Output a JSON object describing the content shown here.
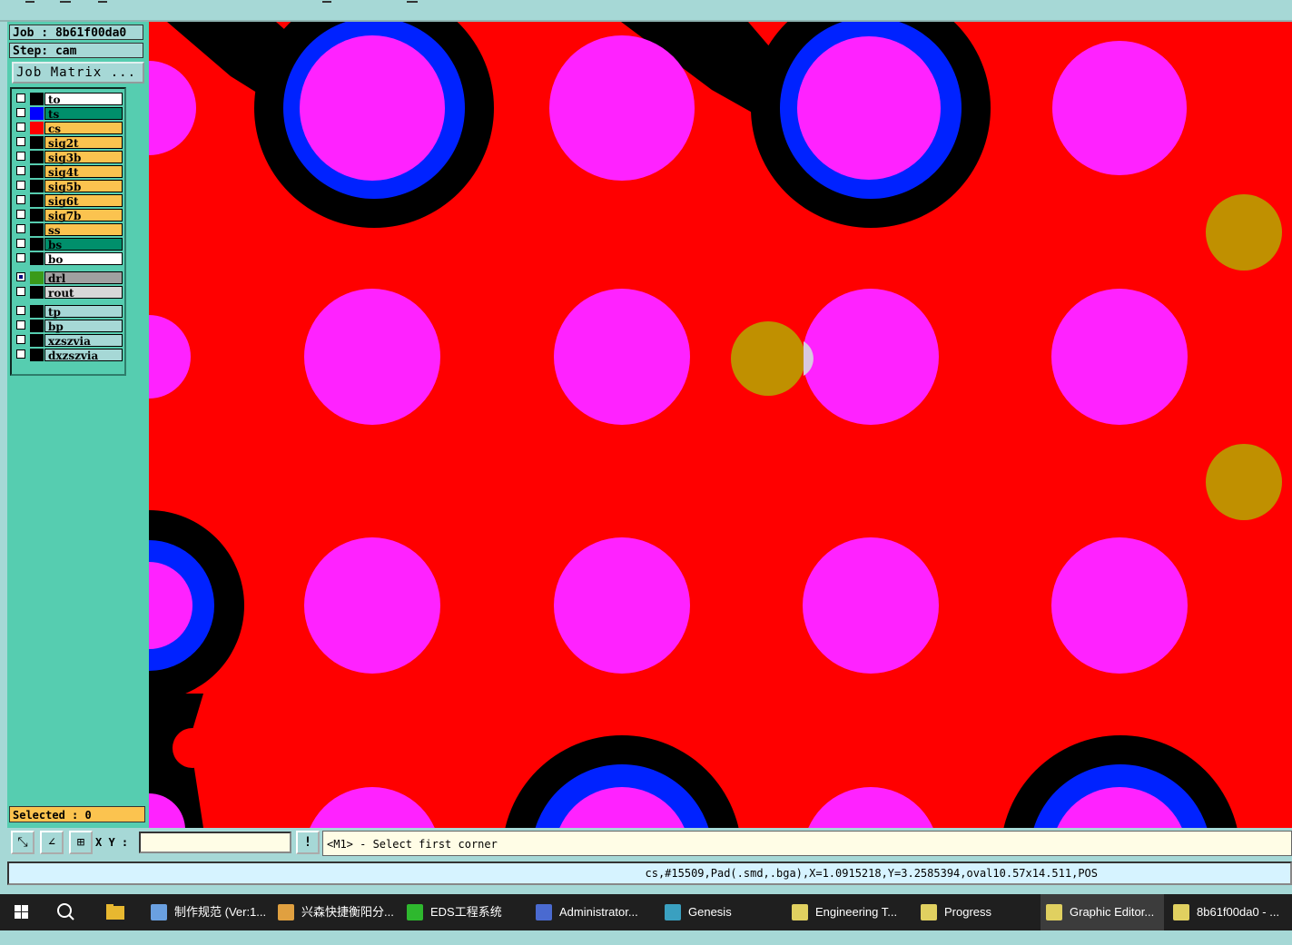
{
  "panel": {
    "job": "Job : 8b61f00da0",
    "step": "Step: cam",
    "matrix_button": "Job Matrix ...",
    "selected": "Selected : 0"
  },
  "layers": [
    {
      "name": "to",
      "swatch": "#000000",
      "bg": "#ffffff",
      "checked": false
    },
    {
      "name": "ts",
      "swatch": "#0000ff",
      "bg": "#008f6b",
      "checked": false
    },
    {
      "name": "cs",
      "swatch": "#ff0000",
      "bg": "#fbc34f",
      "checked": false
    },
    {
      "name": "sig2t",
      "swatch": "#000000",
      "bg": "#fbc34f",
      "checked": false
    },
    {
      "name": "sig3b",
      "swatch": "#000000",
      "bg": "#fbc34f",
      "checked": false
    },
    {
      "name": "sig4t",
      "swatch": "#000000",
      "bg": "#fbc34f",
      "checked": false
    },
    {
      "name": "sig5b",
      "swatch": "#000000",
      "bg": "#fbc34f",
      "checked": false
    },
    {
      "name": "sig6t",
      "swatch": "#000000",
      "bg": "#fbc34f",
      "checked": false
    },
    {
      "name": "sig7b",
      "swatch": "#000000",
      "bg": "#fbc34f",
      "checked": false
    },
    {
      "name": "ss",
      "swatch": "#000000",
      "bg": "#fbc34f",
      "checked": false
    },
    {
      "name": "bs",
      "swatch": "#000000",
      "bg": "#008f6b",
      "checked": false
    },
    {
      "name": "bo",
      "swatch": "#000000",
      "bg": "#ffffff",
      "checked": false
    },
    {
      "name": "drl",
      "swatch": "#3a9a1a",
      "bg": "#a0a0a0",
      "checked": true
    },
    {
      "name": "rout",
      "swatch": "#000000",
      "bg": "#d8d8d8",
      "checked": false
    },
    {
      "name": "tp",
      "swatch": "#000000",
      "bg": "#a6d8d6",
      "checked": false
    },
    {
      "name": "bp",
      "swatch": "#000000",
      "bg": "#a6d8d6",
      "checked": false
    },
    {
      "name": "xzszvia",
      "swatch": "#000000",
      "bg": "#a6d8d6",
      "checked": false
    },
    {
      "name": "dxzszvia",
      "swatch": "#000000",
      "bg": "#a6d8d6",
      "checked": false
    }
  ],
  "toolbar": {
    "xy_label": "X Y :",
    "xy_value": "",
    "prompt": "<M1> - Select first corner",
    "alert_icon": "!"
  },
  "status": "cs,#15509,Pad(.smd,.bga),X=1.0915218,Y=3.2585394,oval10.57x14.511,POS",
  "colors": {
    "copper": "#ff0000",
    "pad": "#ff22ff",
    "solder_mask": "#0022ff",
    "clearance": "#000000",
    "drill": "#c09000"
  },
  "taskbar": [
    {
      "label": "制作规范 (Ver:1...",
      "icon": "document-icon",
      "color": "#6aa0e0"
    },
    {
      "label": "兴森快捷衡阳分...",
      "icon": "shell-icon",
      "color": "#e0a040"
    },
    {
      "label": "EDS工程系统",
      "icon": "eds-f-icon",
      "color": "#2eb82e"
    },
    {
      "label": "Administrator...",
      "icon": "floppy-icon",
      "color": "#4a6ad0"
    },
    {
      "label": "Genesis",
      "icon": "genesis-icon",
      "color": "#3aa0c0"
    },
    {
      "label": "Engineering T...",
      "icon": "x-window-icon",
      "color": "#e0d060"
    },
    {
      "label": "Progress",
      "icon": "x-window-icon",
      "color": "#e0d060"
    },
    {
      "label": "Graphic Editor...",
      "icon": "x-window-icon",
      "color": "#e0d060",
      "active": true
    },
    {
      "label": "8b61f00da0 - ...",
      "icon": "x-window-icon",
      "color": "#e0d060"
    }
  ]
}
